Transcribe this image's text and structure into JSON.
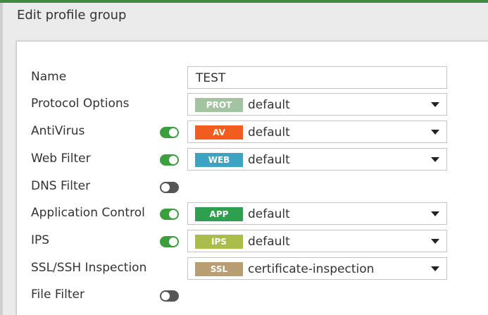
{
  "colors": {
    "accent": "#3d8b40",
    "toggle_on": "#3d9e3d",
    "toggle_off": "#555555"
  },
  "header": {
    "title": "Edit profile group"
  },
  "form": {
    "name": {
      "label": "Name",
      "value": "TEST"
    },
    "protocol_options": {
      "label": "Protocol Options",
      "badge": "PROT",
      "badge_color": "#a3c4a0",
      "value": "default"
    },
    "antivirus": {
      "label": "AntiVirus",
      "enabled": true,
      "badge": "AV",
      "badge_color": "#f25c1f",
      "value": "default"
    },
    "web_filter": {
      "label": "Web Filter",
      "enabled": true,
      "badge": "WEB",
      "badge_color": "#3da3c2",
      "value": "default"
    },
    "dns_filter": {
      "label": "DNS Filter",
      "enabled": false
    },
    "application_control": {
      "label": "Application Control",
      "enabled": true,
      "badge": "APP",
      "badge_color": "#2e9e4f",
      "value": "default"
    },
    "ips": {
      "label": "IPS",
      "enabled": true,
      "badge": "IPS",
      "badge_color": "#aabd4a",
      "value": "default"
    },
    "ssl_inspection": {
      "label": "SSL/SSH Inspection",
      "badge": "SSL",
      "badge_color": "#b89e72",
      "value": "certificate-inspection"
    },
    "file_filter": {
      "label": "File Filter",
      "enabled": false
    }
  },
  "icons": {
    "dropdown": "caret-down-icon"
  }
}
